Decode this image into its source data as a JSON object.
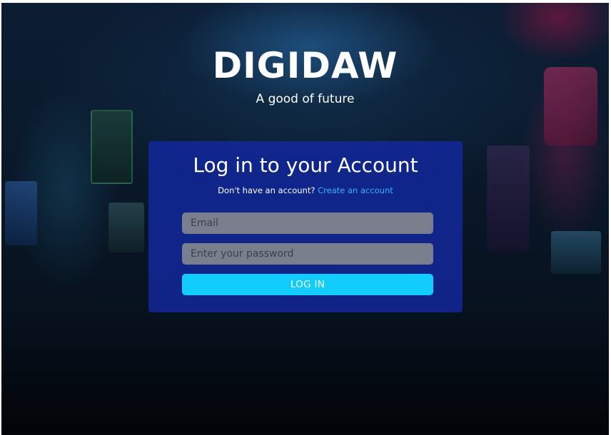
{
  "brand": {
    "title": "DIGIDAW",
    "subtitle": "A good of future"
  },
  "login": {
    "heading": "Log in to your Account",
    "signup_prompt": "Don't have an account?",
    "signup_link": "Create an account",
    "email_placeholder": "Email",
    "password_placeholder": "Enter your password",
    "submit_label": "LOG IN"
  },
  "colors": {
    "card_background": "#1228a0",
    "accent_button": "#11cdfb",
    "link": "#2fb3ff",
    "input_background": "#7a7f8e"
  }
}
